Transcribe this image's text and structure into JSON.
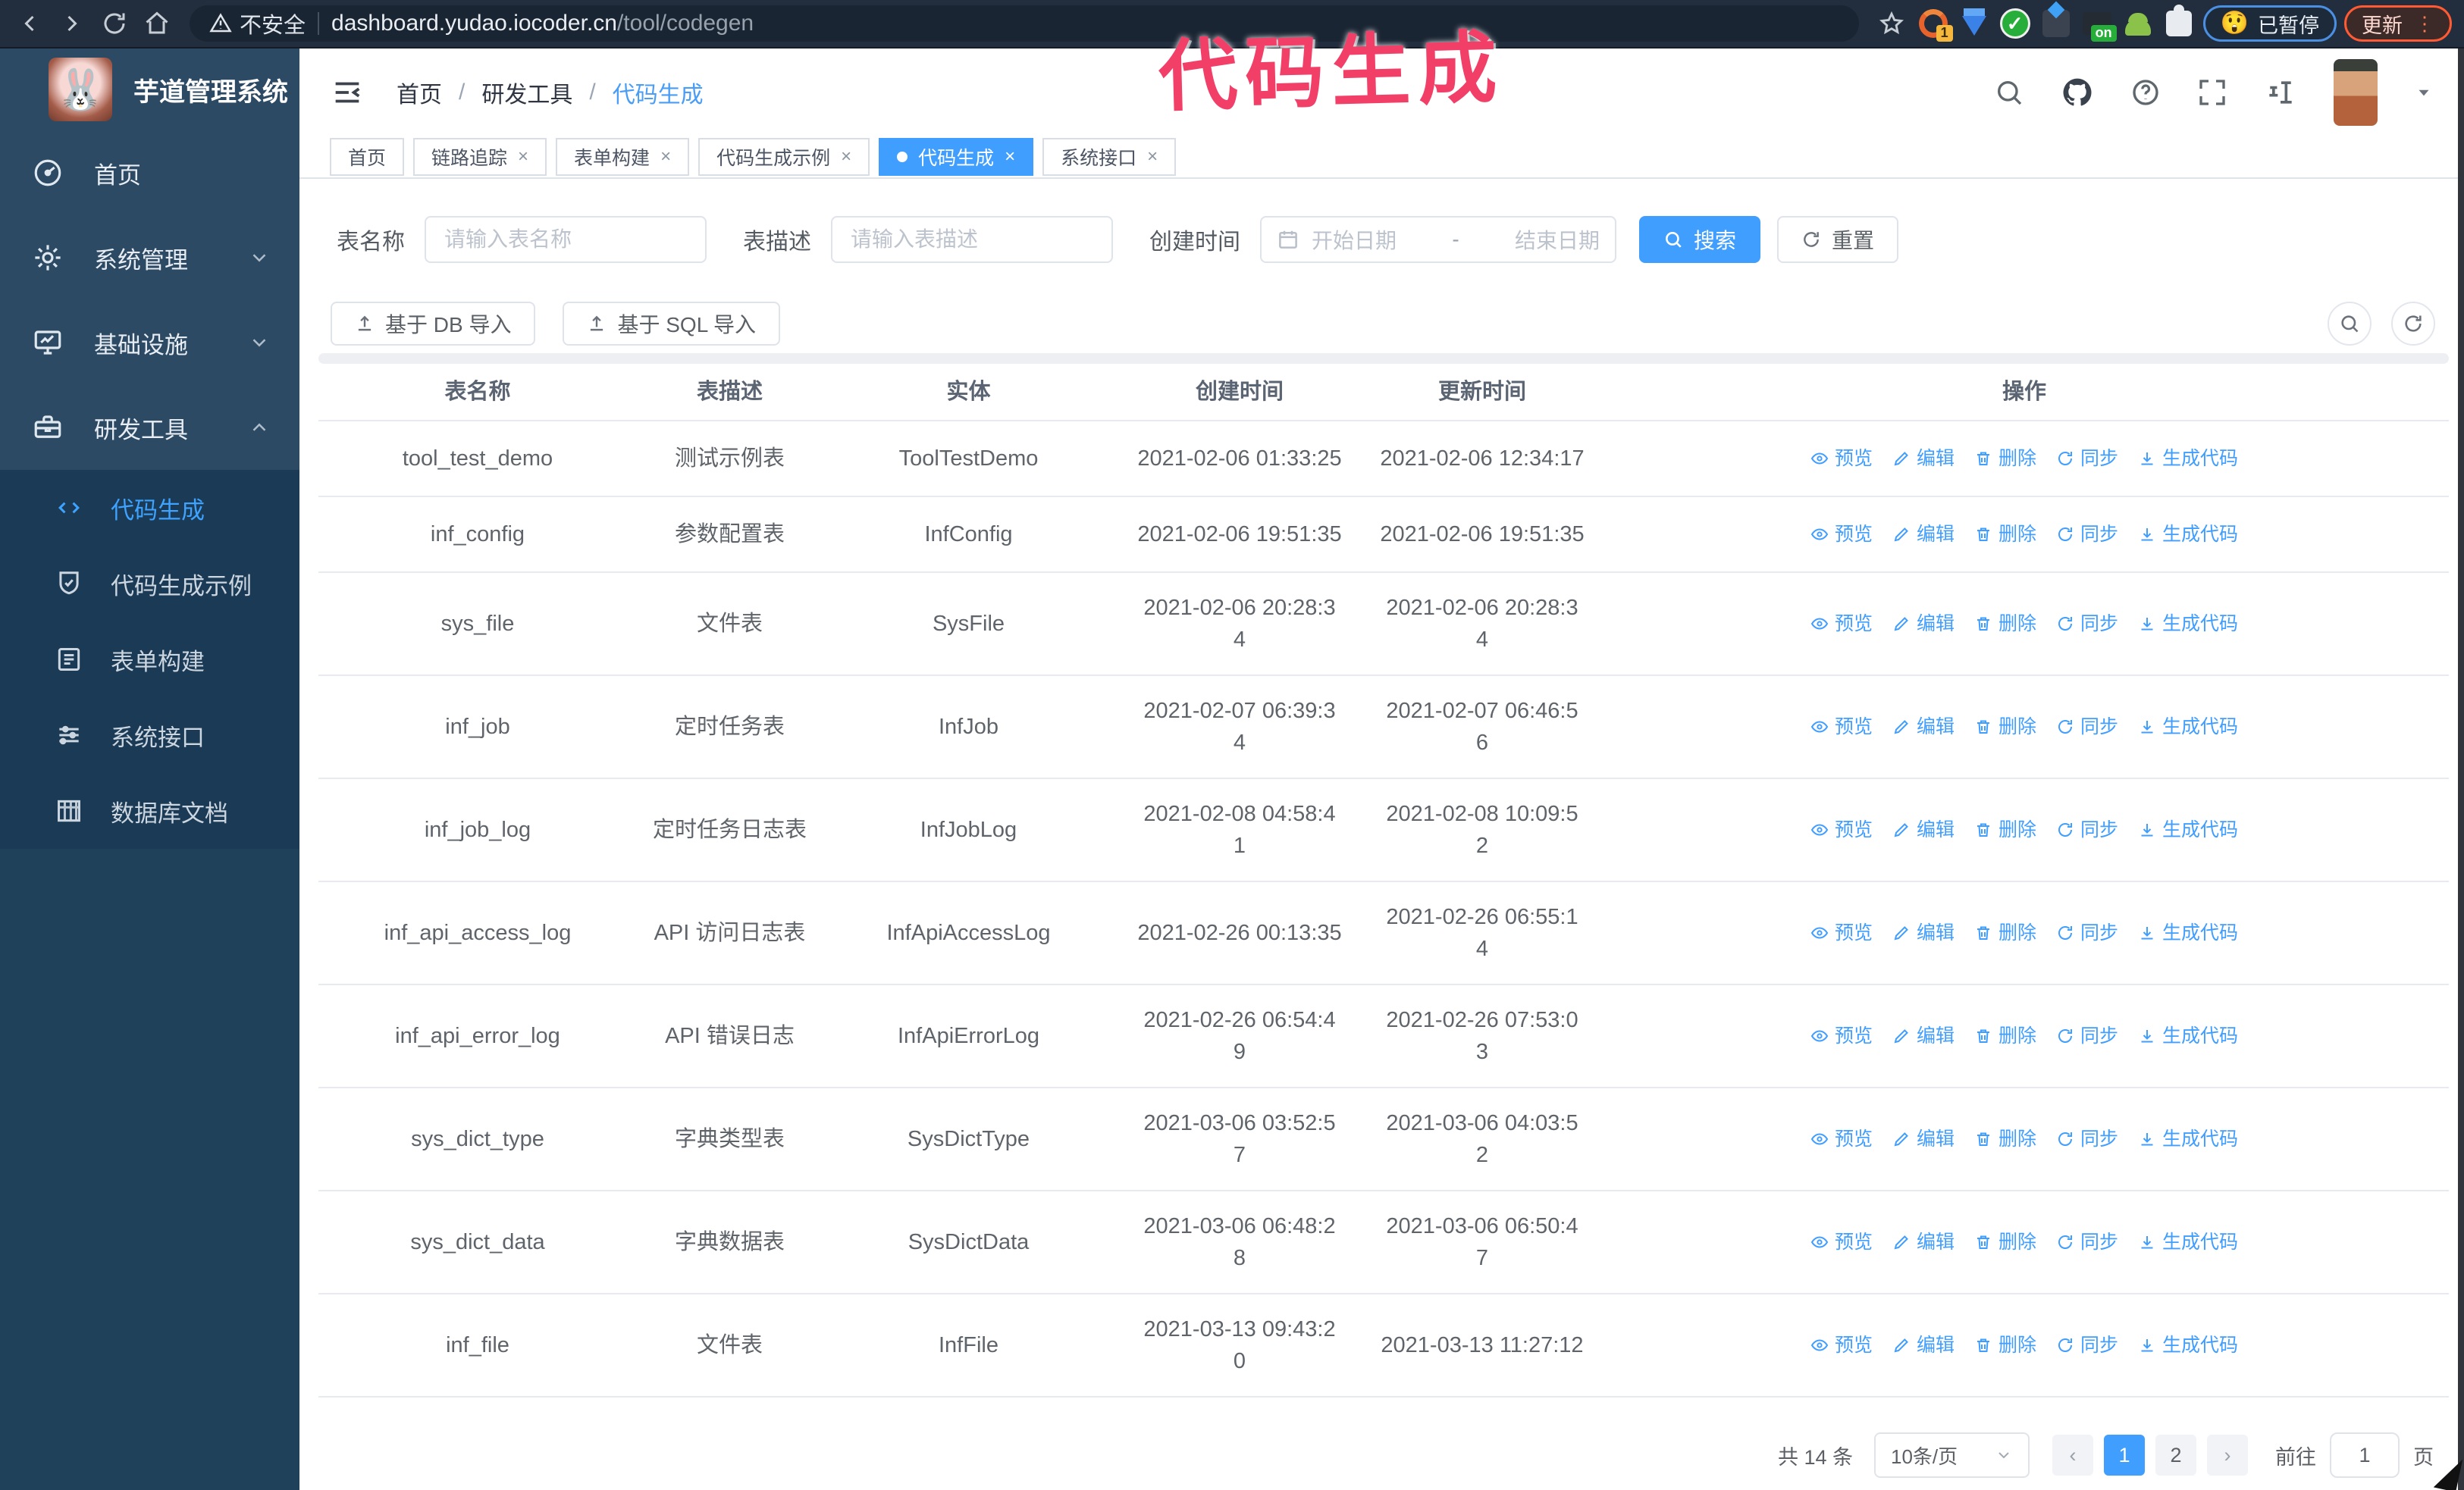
{
  "browser": {
    "security_warning": "不安全",
    "url_host": "dashboard.yudao.iocoder.cn",
    "url_path": "/tool/codegen",
    "extension_badge_count": "1",
    "extension_badge_on": "on",
    "paused_emoji": "😲",
    "paused_badge": "已暂停",
    "update_button": "更新",
    "update_menu_dots": "⋮"
  },
  "annotation": {
    "text": "代码生成",
    "color": "#f23f68"
  },
  "sidebar": {
    "logo_title": "芋道管理系统",
    "logo_emoji": "🐰",
    "menu": [
      {
        "label": "首页",
        "icon": "dashboard-icon",
        "expandable": false
      },
      {
        "label": "系统管理",
        "icon": "gear-icon",
        "expandable": true,
        "expanded": false
      },
      {
        "label": "基础设施",
        "icon": "monitor-icon",
        "expandable": true,
        "expanded": false
      },
      {
        "label": "研发工具",
        "icon": "toolbox-icon",
        "expandable": true,
        "expanded": true
      }
    ],
    "submenu": [
      {
        "label": "代码生成",
        "icon": "code-icon",
        "active": true
      },
      {
        "label": "代码生成示例",
        "icon": "medal-icon",
        "active": false
      },
      {
        "label": "表单构建",
        "icon": "form-icon",
        "active": false
      },
      {
        "label": "系统接口",
        "icon": "sliders-icon",
        "active": false
      },
      {
        "label": "数据库文档",
        "icon": "db-table-icon",
        "active": false
      }
    ]
  },
  "header": {
    "breadcrumb": [
      "首页",
      "研发工具",
      "代码生成"
    ],
    "separator": "/"
  },
  "tabs": [
    {
      "label": "首页",
      "closable": false,
      "active": false
    },
    {
      "label": "链路追踪",
      "closable": true,
      "active": false
    },
    {
      "label": "表单构建",
      "closable": true,
      "active": false
    },
    {
      "label": "代码生成示例",
      "closable": true,
      "active": false
    },
    {
      "label": "代码生成",
      "closable": true,
      "active": true
    },
    {
      "label": "系统接口",
      "closable": true,
      "active": false
    }
  ],
  "filters": {
    "table_name_label": "表名称",
    "table_name_placeholder": "请输入表名称",
    "table_desc_label": "表描述",
    "table_desc_placeholder": "请输入表描述",
    "create_time_label": "创建时间",
    "start_placeholder": "开始日期",
    "range_separator": "-",
    "end_placeholder": "结束日期",
    "search_label": "搜索",
    "reset_label": "重置"
  },
  "toolbar": {
    "import_db_label": "基于 DB 导入",
    "import_sql_label": "基于 SQL 导入"
  },
  "table": {
    "columns": [
      "表名称",
      "表描述",
      "实体",
      "创建时间",
      "更新时间",
      "操作"
    ],
    "actions": [
      "预览",
      "编辑",
      "删除",
      "同步",
      "生成代码"
    ],
    "rows": [
      {
        "name": "tool_test_demo",
        "desc": "测试示例表",
        "entity": "ToolTestDemo",
        "created": "2021-02-06 01:33:25",
        "updated": "2021-02-06 12:34:17"
      },
      {
        "name": "inf_config",
        "desc": "参数配置表",
        "entity": "InfConfig",
        "created": "2021-02-06 19:51:35",
        "updated": "2021-02-06 19:51:35"
      },
      {
        "name": "sys_file",
        "desc": "文件表",
        "entity": "SysFile",
        "created": "2021-02-06 20:28:3\n4",
        "updated": "2021-02-06 20:28:3\n4"
      },
      {
        "name": "inf_job",
        "desc": "定时任务表",
        "entity": "InfJob",
        "created": "2021-02-07 06:39:3\n4",
        "updated": "2021-02-07 06:46:5\n6"
      },
      {
        "name": "inf_job_log",
        "desc": "定时任务日志表",
        "entity": "InfJobLog",
        "created": "2021-02-08 04:58:4\n1",
        "updated": "2021-02-08 10:09:5\n2"
      },
      {
        "name": "inf_api_access_log",
        "desc": "API 访问日志表",
        "entity": "InfApiAccessLog",
        "created": "2021-02-26 00:13:35",
        "updated": "2021-02-26 06:55:1\n4"
      },
      {
        "name": "inf_api_error_log",
        "desc": "API 错误日志",
        "entity": "InfApiErrorLog",
        "created": "2021-02-26 06:54:4\n9",
        "updated": "2021-02-26 07:53:0\n3"
      },
      {
        "name": "sys_dict_type",
        "desc": "字典类型表",
        "entity": "SysDictType",
        "created": "2021-03-06 03:52:5\n7",
        "updated": "2021-03-06 04:03:5\n2"
      },
      {
        "name": "sys_dict_data",
        "desc": "字典数据表",
        "entity": "SysDictData",
        "created": "2021-03-06 06:48:2\n8",
        "updated": "2021-03-06 06:50:4\n7"
      },
      {
        "name": "inf_file",
        "desc": "文件表",
        "entity": "InfFile",
        "created": "2021-03-13 09:43:2\n0",
        "updated": "2021-03-13 11:27:12"
      }
    ]
  },
  "pagination": {
    "total": "共 14 条",
    "page_size": "10条/页",
    "pages": [
      "1",
      "2"
    ],
    "active_page": "1",
    "goto_label": "前往",
    "goto_value": "1",
    "page_suffix": "页"
  },
  "colors": {
    "primary": "#409eff",
    "annotation_pink": "#f23f68",
    "sidebar_bg": "#2c4a64",
    "submenu_bg": "#1b3a55",
    "chrome_bg": "#222e3e"
  }
}
